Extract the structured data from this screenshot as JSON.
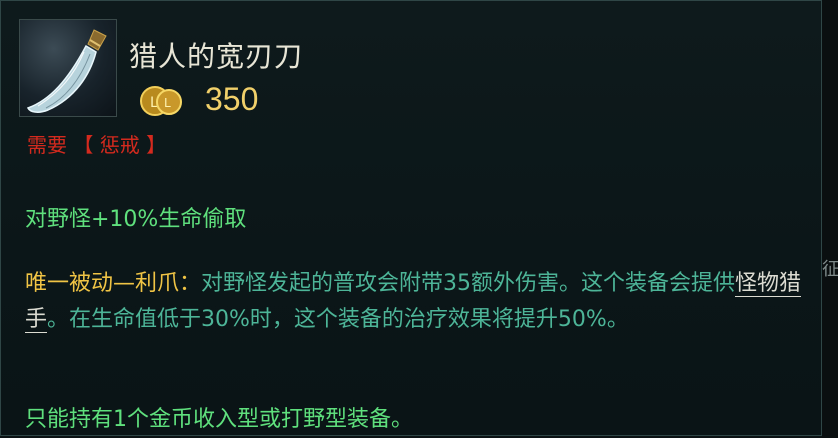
{
  "item": {
    "name": "猎人的宽刃刀",
    "icon": "machete-icon",
    "cost": "350",
    "coin_icon": "gold-coin-icon"
  },
  "requires": {
    "label": "需要",
    "bracket_open": "【",
    "value": "惩戒",
    "bracket_close": "】"
  },
  "stats": {
    "line1": "对野怪+10%生命偷取"
  },
  "passive": {
    "name": "唯一被动—利爪：",
    "text_a": "对野怪发起的普攻会附带35额外伤害。这个装备会提供",
    "link": "怪物猎手",
    "text_b": "。在生命值低于30%时，这个装备的治疗效果将提升50%。"
  },
  "limit": {
    "text": "只能持有1个金币收入型或打野型装备。"
  },
  "edge": {
    "glyph": "征"
  },
  "colors": {
    "cost": "#f1d06a",
    "requires": "#d42a1e",
    "stat_green": "#5fe07d",
    "passive_teal": "#4db598",
    "passive_name_gold": "#f0c445"
  }
}
